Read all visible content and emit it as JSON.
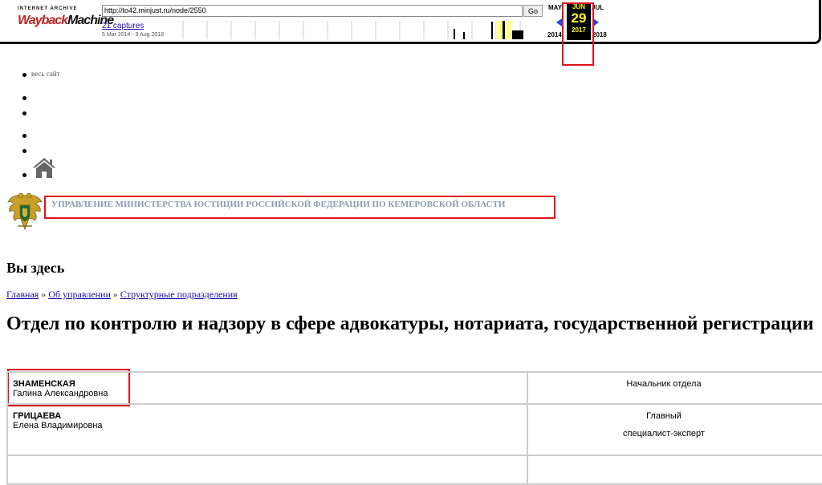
{
  "wayback": {
    "logo_top": "INTERNET ARCHIVE",
    "logo_wayback": "Wayback",
    "logo_machine": "Machine",
    "url": "http://to42.minjust.ru/node/2550",
    "go_label": "Go",
    "captures": "21 captures",
    "range": "5 Mar 2014 - 9 Aug 2018",
    "prev_month": "MAY",
    "current_month": "JUN",
    "next_month": "JUL",
    "day": "29",
    "prev_year": "2014",
    "current_year": "2017",
    "next_year": "2018"
  },
  "menu": {
    "site_link": "весь сайт"
  },
  "agency": "УПРАВЛЕНИЕ МИНИСТЕРСТВА ЮСТИЦИИ РОССИЙСКОЙ ФЕДЕРАЦИИ ПО КЕМЕРОВСКОЙ ОБЛАСТИ",
  "you_are_here": "Вы здесь",
  "breadcrumb": {
    "home": "Главная",
    "sep": "»",
    "about": "Об управлении",
    "units": "Структурные подразделения"
  },
  "page_title": "Отдел по контролю и надзору в сфере адвокатуры, нотариата, государственной регистрации",
  "staff": [
    {
      "surname": "ЗНАМЕНСКАЯ",
      "name": "Галина Александровна",
      "position": [
        "Начальник отдела"
      ]
    },
    {
      "surname": "ГРИЦАЕВА",
      "name": "Елена Владимировна",
      "position": [
        "Главный",
        "специалист-эксперт"
      ]
    }
  ],
  "colors": {
    "highlight": "#e0141e",
    "link": "#1a0dab",
    "agency_text": "#8c9aaf",
    "calendar_current": "#ffff00"
  }
}
